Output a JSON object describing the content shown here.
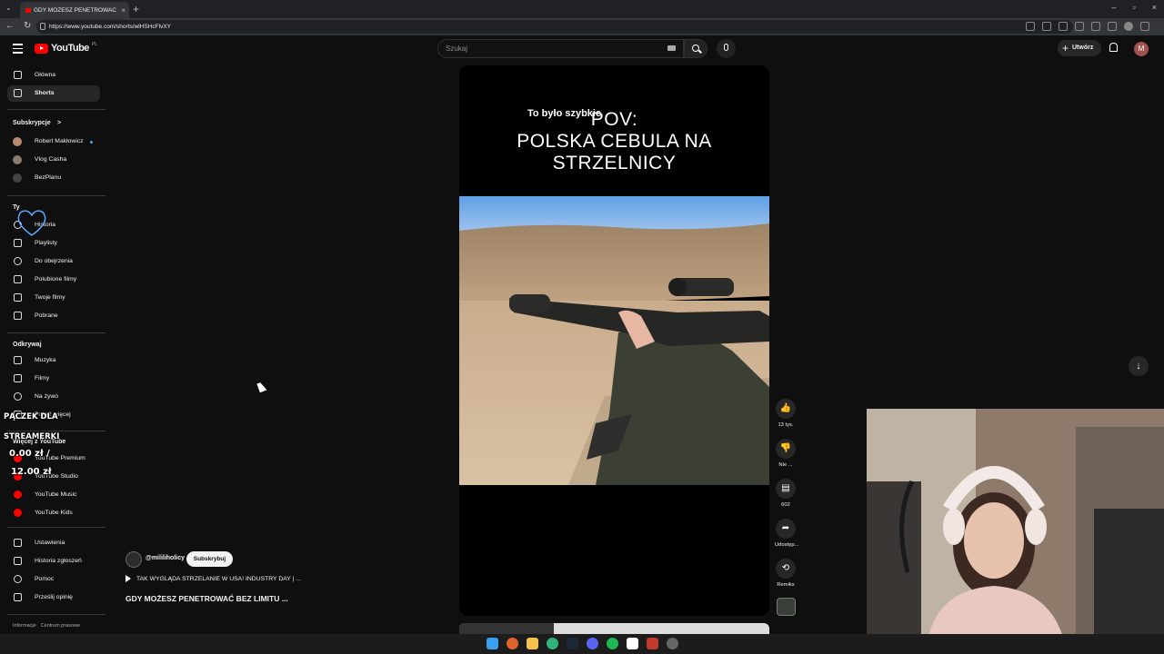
{
  "browser": {
    "tab_title": "GDY MOŻESZ PENETROWAĆ",
    "tab_close": "×",
    "new_tab": "+",
    "url": "https://www.youtube.com/shorts/wlHSHcFlvXY",
    "window_controls": [
      "–",
      "▫",
      "×"
    ],
    "nav": [
      "←",
      "→",
      "↻"
    ]
  },
  "header": {
    "logo_text": "YouTube",
    "country_code": "PL",
    "search_placeholder": "Szukaj",
    "create_label": "Utwórz",
    "create_plus": "+",
    "account_initial": "M"
  },
  "sidebar": {
    "main": [
      {
        "label": "Główna",
        "active": false
      },
      {
        "label": "Shorts",
        "active": true
      }
    ],
    "subscriptions_title": "Subskrypcje",
    "subscriptions_chevron": ">",
    "subscriptions": [
      {
        "label": "Robert Makłowicz",
        "color": "#b98a6e",
        "new": true
      },
      {
        "label": "Vlog Casha",
        "color": "#8e7c6a",
        "new": false
      },
      {
        "label": "BezPlanu",
        "color": "#444444",
        "new": false
      }
    ],
    "you_title": "Ty",
    "you": [
      {
        "label": "Historia"
      },
      {
        "label": "Playlisty"
      },
      {
        "label": "Do obejrzenia"
      },
      {
        "label": "Polubione filmy"
      },
      {
        "label": "Twoje filmy"
      },
      {
        "label": "Pobrane"
      }
    ],
    "explore_title": "Odkrywaj",
    "explore": [
      {
        "label": "Muzyka"
      },
      {
        "label": "Filmy"
      },
      {
        "label": "Na żywo"
      },
      {
        "label": "Pokaż więcej"
      }
    ],
    "more_title": "Więcej z YouTube",
    "more": [
      {
        "label": "YouTube Premium"
      },
      {
        "label": "YouTube Studio"
      },
      {
        "label": "YouTube Music"
      },
      {
        "label": "YouTube Kids"
      }
    ],
    "settings": [
      {
        "label": "Ustawienia"
      },
      {
        "label": "Historia zgłoszeń"
      },
      {
        "label": "Pomoc"
      },
      {
        "label": "Prześlij opinię"
      }
    ],
    "footer_links": [
      "Informacje",
      "Centrum prasowe"
    ]
  },
  "overlay": {
    "donation_line1": "PĄCZEK DLA",
    "donation_line2": "STREAMERKI",
    "amount_current": "0.00 zł /",
    "amount_goal": "12.00 zł",
    "progress": 0.0
  },
  "short": {
    "caption": "To było szybkie",
    "title_line1": "POV:",
    "title_line2": "POLSKA CEBULA NA",
    "title_line3": "STRZELNICY",
    "channel_handle": "@mililiholicy",
    "subscribe_label": "Subskrybuj",
    "related_label": "TAK WYGLĄDA STRZELANIE W USA! INDUSTRY DAY | ...",
    "headline": "GDY MOŻESZ PENETROWAĆ BEZ LIMITU ..."
  },
  "actions": {
    "like_count": "13 tys.",
    "dislike_label": "Nie ...",
    "comments_count": "602",
    "share_label": "Udostęp...",
    "remix_label": "Remiks"
  },
  "nav_down_arrow": "↓",
  "colors": {
    "background": "#0f0f0f",
    "accent": "#ff0000",
    "active_item": "#272727"
  }
}
